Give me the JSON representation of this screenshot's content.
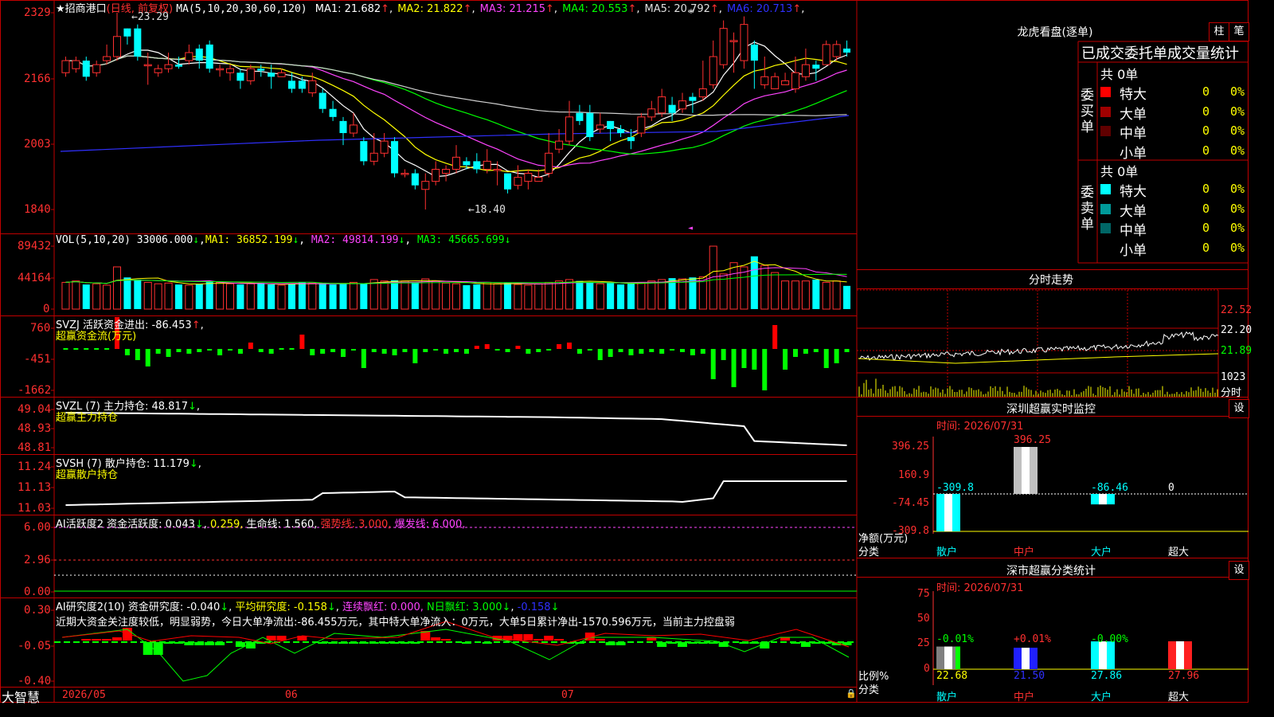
{
  "kline": {
    "title_star": "★",
    "stock_name": "招商港口",
    "period": "(日线, 前复权)",
    "ma_spec": "MA(5,10,20,30,60,120)",
    "ma_values": [
      {
        "label": "MA1:",
        "value": "21.682",
        "color": "#ffffff"
      },
      {
        "label": "MA2:",
        "value": "21.822",
        "color": "#ffff00"
      },
      {
        "label": "MA3:",
        "value": "21.215",
        "color": "#ff44ff"
      },
      {
        "label": "MA4:",
        "value": "20.553",
        "color": "#00ff00"
      },
      {
        "label": "MA5:",
        "value": "20.792",
        "color": "#e0e0e0"
      },
      {
        "label": "MA6:",
        "value": "20.713",
        "color": "#3030ff"
      }
    ],
    "up_arrow": "↑",
    "down_arrow": "↓",
    "y_ticks": [
      "2329",
      "2166",
      "2003",
      "1840"
    ],
    "high_label": "←23.29",
    "low_label": "←18.40",
    "high_value": 23.29,
    "low_value": 18.4,
    "y_range": [
      18.4,
      23.29
    ]
  },
  "vol": {
    "header_name": "VOL(5,10,20)",
    "header_value": "33006.000",
    "ma1": "MA1: 36852.199",
    "ma2": "MA2: 49814.199",
    "ma3": "MA3: 45665.699",
    "y_ticks": [
      "89432",
      "44164",
      "0"
    ]
  },
  "svzj": {
    "header": "SVZJ  活跃资金进出: -86.453",
    "sub": "超赢资金流(万元)",
    "y_ticks": [
      "760",
      "-451",
      "-1662"
    ]
  },
  "svzl": {
    "header": "SVZL (7) 主力持仓: 48.817",
    "sub": "超赢主力持仓",
    "y_ticks": [
      "49.04",
      "48.93",
      "48.81"
    ]
  },
  "svsh": {
    "header": "SVSH (7) 散户持仓: 11.179",
    "sub": "超赢散户持仓",
    "y_ticks": [
      "11.24",
      "11.13",
      "11.03"
    ]
  },
  "ai_active": {
    "name": "AI活跃度2",
    "part1": "资金活跃度: 0.043",
    "part2": "0.259,",
    "part3": "生命线: 1.560,",
    "part4": "强势线: 3.000,",
    "part5": "爆发线: 6.000,",
    "y_ticks": [
      "6.00",
      "2.96",
      "0.00"
    ]
  },
  "ai_research": {
    "name": "AI研究度2(10)",
    "part1": "资金研究度: -0.040",
    "part2": "平均研究度: -0.158",
    "part3": "连续飘红: 0.000,",
    "part4": "N日飘红: 3.000",
    "part5": "-0.158",
    "comment": "近期大资金关注度较低，明显弱势，今日大单净流出:-86.455万元，其中特大单净流入：0万元，大单5日累计净出-1570.596万元，当前主力控盘弱",
    "y_ticks": [
      "0.30",
      "-0.05",
      "-0.40"
    ]
  },
  "x_axis": {
    "labels": [
      "2026/05",
      "06",
      "07"
    ],
    "brand": "大智慧"
  },
  "dragon_tiger": {
    "title": "龙虎看盘(逐单)",
    "tab_bar": "柱",
    "tab_pen": "笔",
    "header": "已成交委托单成交量统计",
    "buy_side": "委买单",
    "sell_side": "委卖单",
    "buy_total": "共 0单",
    "sell_total": "共 0单",
    "buy_rows": [
      {
        "name": "特大",
        "count": "0",
        "pct": "0%",
        "color": "#ff0000"
      },
      {
        "name": "大单",
        "count": "0",
        "pct": "0%",
        "color": "#a00000"
      },
      {
        "name": "中单",
        "count": "0",
        "pct": "0%",
        "color": "#600000"
      },
      {
        "name": "小单",
        "count": "0",
        "pct": "0%",
        "color": ""
      }
    ],
    "sell_rows": [
      {
        "name": "特大",
        "count": "0",
        "pct": "0%",
        "color": "#00ffff"
      },
      {
        "name": "大单",
        "count": "0",
        "pct": "0%",
        "color": "#009999"
      },
      {
        "name": "中单",
        "count": "0",
        "pct": "0%",
        "color": "#006666"
      },
      {
        "name": "小单",
        "count": "0",
        "pct": "0%",
        "color": ""
      }
    ]
  },
  "intraday": {
    "title": "分时走势",
    "price_ticks": [
      "22.52",
      "22.20",
      "21.89"
    ],
    "vol_tick": "1023",
    "vol_unit": "分时"
  },
  "sz_monitor": {
    "title": "深圳超赢实时监控",
    "set_btn": "设",
    "time_label": "时间: 2026/07/31",
    "y_ticks": [
      "396.25",
      "160.9",
      "-74.45",
      "-309.8"
    ],
    "bar_labels": [
      "-309.8",
      "396.25",
      "-86.46",
      "0"
    ],
    "values": [
      -309.8,
      396.25,
      -86.46,
      0
    ],
    "y_label": "净额(万元)",
    "x_label": "分类",
    "categories": [
      "散户",
      "中户",
      "大户",
      "超大"
    ]
  },
  "sz_class": {
    "title": "深市超赢分类统计",
    "set_btn": "设",
    "time_label": "时间: 2026/07/31",
    "y_ticks": [
      "75",
      "50",
      "25",
      "0"
    ],
    "change_labels": [
      "-0.01%",
      "+0.01%",
      "-0.00%",
      ""
    ],
    "values": [
      22.68,
      21.5,
      27.86,
      27.96
    ],
    "value_labels": [
      "22.68",
      "21.50",
      "27.86",
      "27.96"
    ],
    "y_label": "比例%",
    "x_label": "分类",
    "categories": [
      "散户",
      "中户",
      "大户",
      "超大"
    ]
  },
  "chart_data": [
    {
      "type": "candlestick",
      "title": "招商港口 (日线, 前复权)",
      "ylim": [
        18.4,
        23.29
      ],
      "high": 23.29,
      "low": 18.4,
      "x_labels": [
        "2026/05",
        "06",
        "07"
      ],
      "candles": [
        [
          21.8,
          22.1,
          22.2,
          21.7
        ],
        [
          21.9,
          22.1,
          22.2,
          21.8
        ],
        [
          22.1,
          21.7,
          22.2,
          21.6
        ],
        [
          21.8,
          22.0,
          22.1,
          21.7
        ],
        [
          22.1,
          22.2,
          22.5,
          22.0
        ],
        [
          22.2,
          22.7,
          23.29,
          22.1
        ],
        [
          22.9,
          22.7,
          22.9,
          22.5
        ],
        [
          22.9,
          22.2,
          23.0,
          22.1
        ],
        [
          22.0,
          22.0,
          22.3,
          21.5
        ],
        [
          21.8,
          21.9,
          22.0,
          21.7
        ],
        [
          21.9,
          22.0,
          22.3,
          21.8
        ],
        [
          22.0,
          21.95,
          22.2,
          21.9
        ],
        [
          22.1,
          22.3,
          22.5,
          22.0
        ],
        [
          22.4,
          22.1,
          22.5,
          21.9
        ],
        [
          22.5,
          21.9,
          22.6,
          21.8
        ],
        [
          21.9,
          21.9,
          22.0,
          21.7
        ],
        [
          21.8,
          21.9,
          22.0,
          21.6
        ],
        [
          21.8,
          21.6,
          21.9,
          21.4
        ],
        [
          21.6,
          21.9,
          22.0,
          21.5
        ],
        [
          21.9,
          21.85,
          22.0,
          21.7
        ],
        [
          21.8,
          21.7,
          22.0,
          21.4
        ],
        [
          21.7,
          21.8,
          21.9,
          21.7
        ],
        [
          21.6,
          21.4,
          21.8,
          21.3
        ],
        [
          21.6,
          21.4,
          21.7,
          21.3
        ],
        [
          21.3,
          21.6,
          21.8,
          21.2
        ],
        [
          21.3,
          20.9,
          21.4,
          20.8
        ],
        [
          20.9,
          20.7,
          21.1,
          20.6
        ],
        [
          20.6,
          20.3,
          20.7,
          20.0
        ],
        [
          20.3,
          20.5,
          20.8,
          20.2
        ],
        [
          20.1,
          19.6,
          20.2,
          19.5
        ],
        [
          19.6,
          19.8,
          20.3,
          19.5
        ],
        [
          19.8,
          20.1,
          20.3,
          19.7
        ],
        [
          20.1,
          19.3,
          20.2,
          19.2
        ],
        [
          19.3,
          19.3,
          19.4,
          19.2
        ],
        [
          19.3,
          19.0,
          19.4,
          18.9
        ],
        [
          18.9,
          19.1,
          19.3,
          18.4
        ],
        [
          19.1,
          19.4,
          19.6,
          19.0
        ],
        [
          19.3,
          19.4,
          19.5,
          19.1
        ],
        [
          19.4,
          19.7,
          20.0,
          19.3
        ],
        [
          19.6,
          19.5,
          19.7,
          19.4
        ],
        [
          19.6,
          19.4,
          19.8,
          19.3
        ],
        [
          19.4,
          19.6,
          19.9,
          19.3
        ],
        [
          19.4,
          19.4,
          19.6,
          19.0
        ],
        [
          19.3,
          18.9,
          19.3,
          18.8
        ],
        [
          19.0,
          19.2,
          19.5,
          18.9
        ],
        [
          19.1,
          19.3,
          19.4,
          18.9
        ],
        [
          19.1,
          19.2,
          19.4,
          19.1
        ],
        [
          19.3,
          19.8,
          20.3,
          19.2
        ],
        [
          19.9,
          20.1,
          20.4,
          19.8
        ],
        [
          20.1,
          20.7,
          21.1,
          20.0
        ],
        [
          20.8,
          20.6,
          21.0,
          20.5
        ],
        [
          20.8,
          20.2,
          21.0,
          20.1
        ],
        [
          20.4,
          20.5,
          20.8,
          20.3
        ],
        [
          20.6,
          20.4,
          20.6,
          20.1
        ],
        [
          20.4,
          20.3,
          20.5,
          20.2
        ],
        [
          20.2,
          20.1,
          20.4,
          19.9
        ],
        [
          20.3,
          20.7,
          20.8,
          20.2
        ],
        [
          20.7,
          20.9,
          21.1,
          20.6
        ],
        [
          20.8,
          21.2,
          21.4,
          20.7
        ],
        [
          21.0,
          20.8,
          21.2,
          20.6
        ],
        [
          20.9,
          21.1,
          21.3,
          20.8
        ],
        [
          21.2,
          21.1,
          21.3,
          20.8
        ],
        [
          21.2,
          21.4,
          22.1,
          21.1
        ],
        [
          21.5,
          22.2,
          22.6,
          21.4
        ],
        [
          22.0,
          22.9,
          23.1,
          21.9
        ],
        [
          22.6,
          22.6,
          22.8,
          21.8
        ],
        [
          22.1,
          23.0,
          23.2,
          21.9
        ],
        [
          22.5,
          22.1,
          22.6,
          21.4
        ],
        [
          21.5,
          21.7,
          22.2,
          21.4
        ],
        [
          21.4,
          21.7,
          21.8,
          21.4
        ],
        [
          21.5,
          21.6,
          21.8,
          21.5
        ],
        [
          21.4,
          21.8,
          22.2,
          21.3
        ],
        [
          21.7,
          22.0,
          22.4,
          21.6
        ],
        [
          22.0,
          21.9,
          22.1,
          21.6
        ],
        [
          22.0,
          22.5,
          22.6,
          22.0
        ],
        [
          22.2,
          22.5,
          22.6,
          22.1
        ],
        [
          22.4,
          22.3,
          22.6,
          22.2
        ]
      ],
      "volumes": [
        38000,
        40000,
        35000,
        36000,
        34000,
        60000,
        45000,
        42000,
        38000,
        36000,
        37000,
        35000,
        34000,
        36000,
        40000,
        38000,
        36000,
        35000,
        36000,
        37000,
        35000,
        34000,
        36000,
        38000,
        37000,
        36000,
        35000,
        36000,
        38000,
        36000,
        42000,
        40000,
        41000,
        40000,
        38000,
        43000,
        40000,
        37000,
        36000,
        34000,
        35000,
        38000,
        36000,
        37000,
        35000,
        34000,
        36000,
        38000,
        40000,
        42000,
        40000,
        38000,
        36000,
        37000,
        35000,
        36000,
        38000,
        40000,
        42000,
        44000,
        43000,
        45000,
        46000,
        89432,
        50000,
        66000,
        60000,
        75000,
        62000,
        52000,
        40000,
        40000,
        40000,
        42000,
        38000,
        40000,
        33006
      ]
    },
    {
      "type": "bar",
      "title": "深圳超赢实时监控",
      "ylabel": "净额(万元)",
      "xlabel": "分类",
      "categories": [
        "散户",
        "中户",
        "大户",
        "超大"
      ],
      "values": [
        -309.8,
        396.25,
        -86.46,
        0
      ],
      "ylim": [
        -309.8,
        396.25
      ]
    },
    {
      "type": "bar",
      "title": "深市超赢分类统计",
      "ylabel": "比例%",
      "xlabel": "分类",
      "categories": [
        "散户",
        "中户",
        "大户",
        "超大"
      ],
      "values": [
        22.68,
        21.5,
        27.86,
        27.96
      ],
      "ylim": [
        0,
        75
      ]
    }
  ]
}
